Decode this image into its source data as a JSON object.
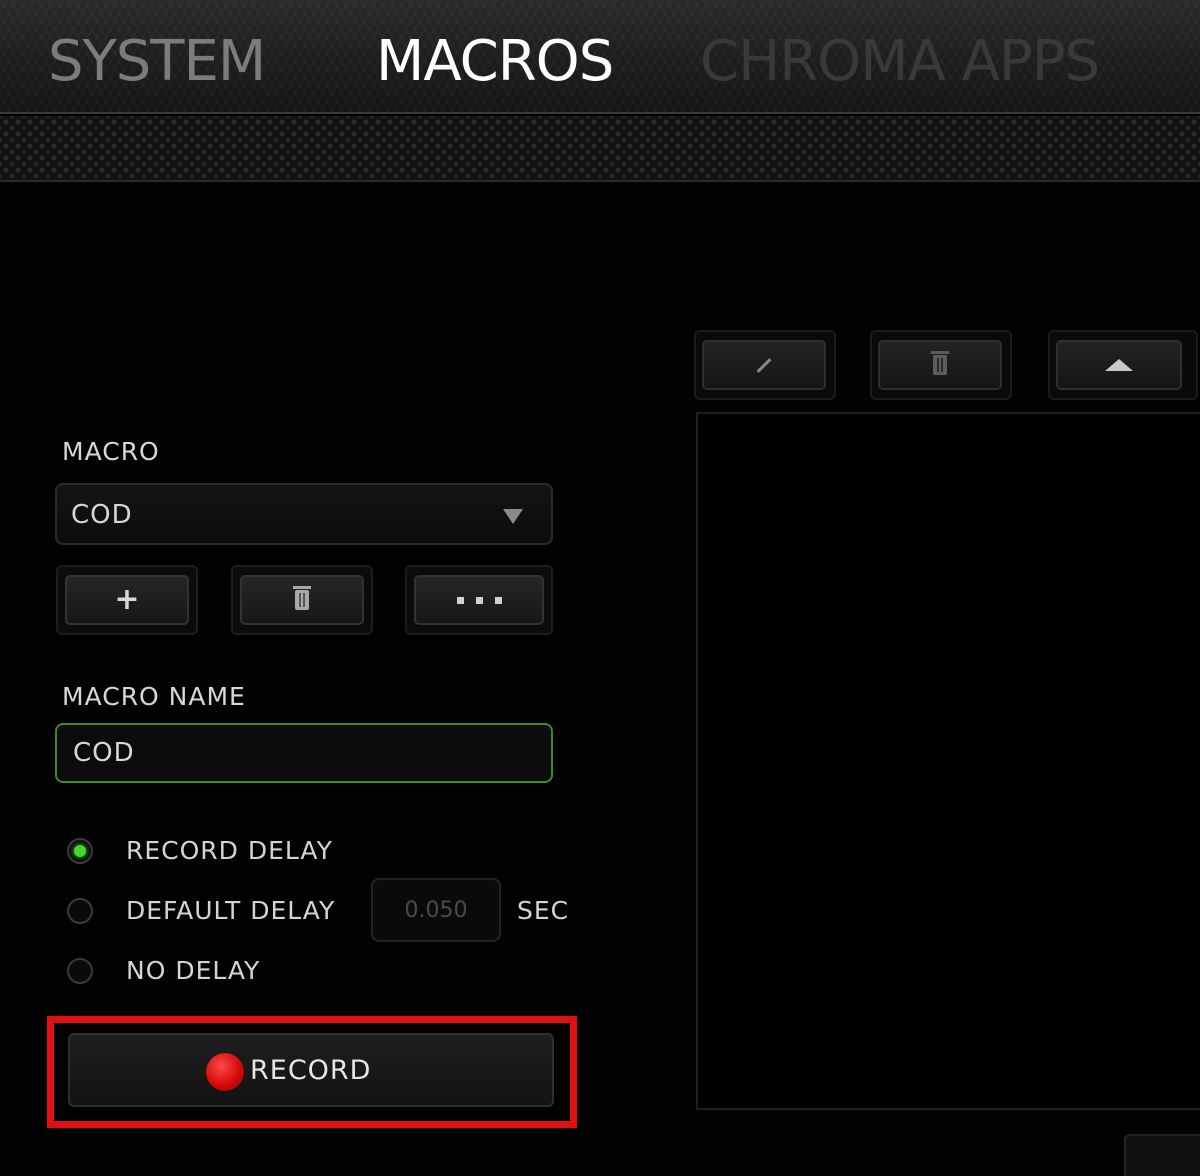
{
  "tabs": {
    "system": "SYSTEM",
    "macros": "MACROS",
    "chroma_apps": "CHROMA APPS"
  },
  "macro": {
    "label": "MACRO",
    "selected": "COD"
  },
  "macro_name": {
    "label": "MACRO NAME",
    "value": "COD"
  },
  "delay_options": {
    "record_delay": "RECORD DELAY",
    "default_delay": "DEFAULT DELAY",
    "no_delay": "NO DELAY",
    "selected": "record_delay",
    "default_delay_value": "0.050",
    "unit": "SEC"
  },
  "record": {
    "label": "RECORD"
  },
  "icons": {
    "add": "plus-icon",
    "delete": "trash-icon",
    "more": "ellipsis-icon",
    "edit": "pencil-icon",
    "move_up": "triangle-up-icon",
    "record": "record-dot-icon",
    "dropdown": "chevron-down-icon"
  },
  "colors": {
    "accent_green": "#44d62c",
    "record_red": "#d40a0a",
    "highlight_red": "#e0120f"
  }
}
